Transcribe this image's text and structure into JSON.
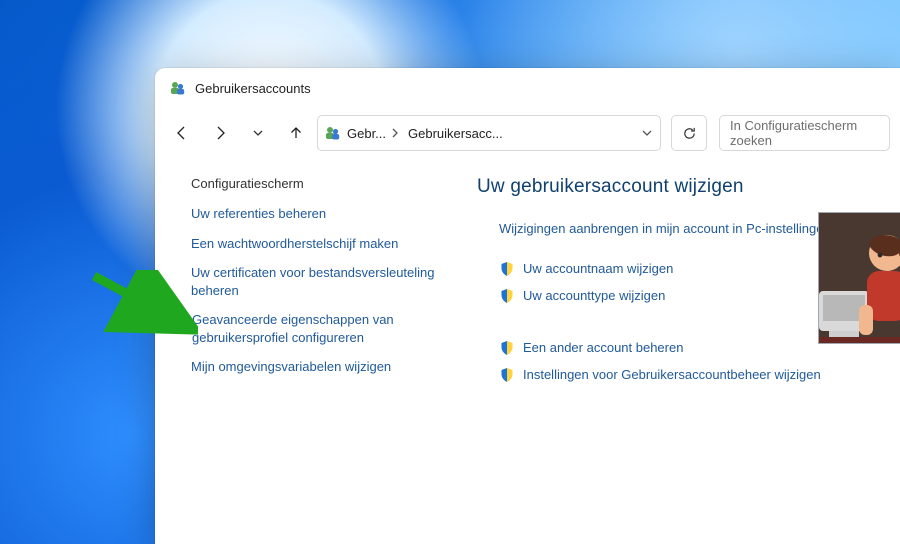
{
  "window_title": "Gebruikersaccounts",
  "breadcrumb": {
    "first": "Gebr...",
    "second": "Gebruikersacc..."
  },
  "search_placeholder": "In Configuratiescherm zoeken",
  "sidebar": {
    "heading": "Configuratiescherm",
    "items": [
      {
        "label": "Uw referenties beheren",
        "shield": false
      },
      {
        "label": "Een wachtwoordherstelschijf maken",
        "shield": false
      },
      {
        "label": "Uw certificaten voor bestandsversleuteling beheren",
        "shield": false
      },
      {
        "label": "Geavanceerde eigenschappen van gebruikersprofiel configureren",
        "shield": true
      },
      {
        "label": "Mijn omgevingsvariabelen wijzigen",
        "shield": false
      }
    ]
  },
  "content": {
    "heading": "Uw gebruikersaccount wijzigen",
    "links": [
      {
        "label": "Wijzigingen aanbrengen in mijn account in Pc-instellingen",
        "shield": false
      },
      {
        "label": "Uw accountnaam wijzigen",
        "shield": true
      },
      {
        "label": "Uw accounttype wijzigen",
        "shield": true
      },
      {
        "label": "Een ander account beheren",
        "shield": true
      },
      {
        "label": "Instellingen voor Gebruikersaccountbeheer wijzigen",
        "shield": true
      }
    ]
  }
}
